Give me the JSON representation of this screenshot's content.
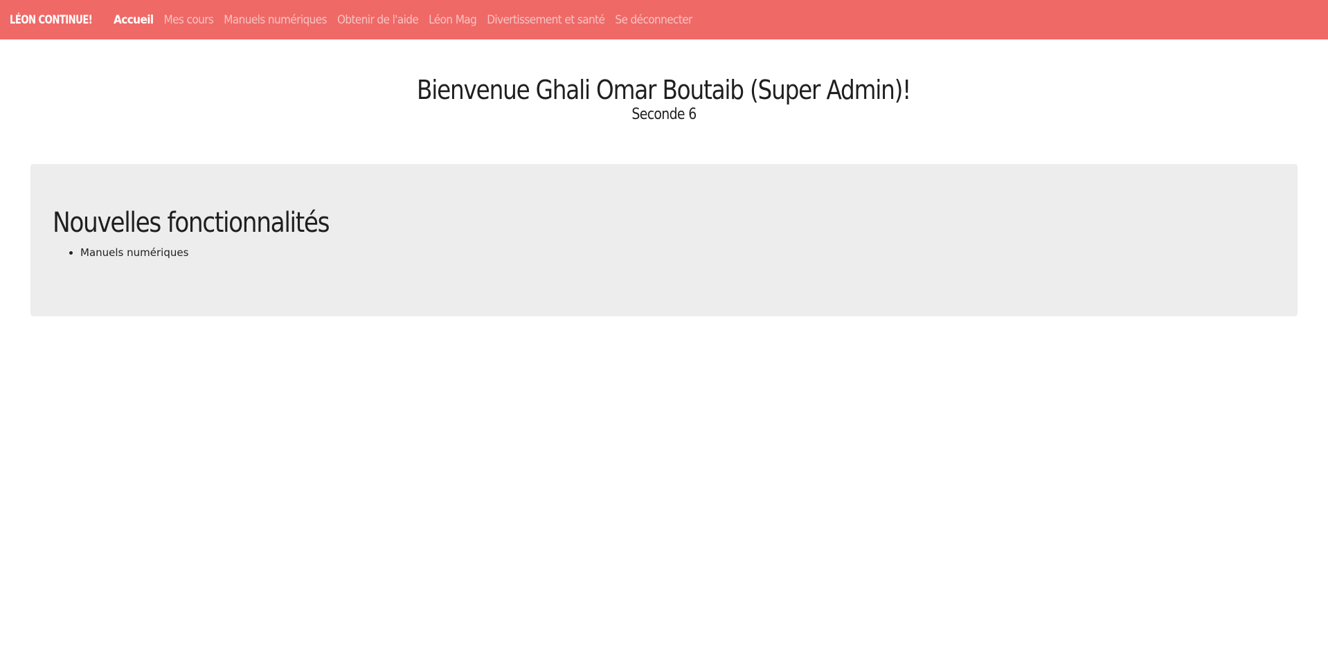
{
  "navbar": {
    "brand": "LÉON CONTINUE!",
    "links": [
      {
        "label": "Accueil",
        "active": true
      },
      {
        "label": "Mes cours",
        "active": false
      },
      {
        "label": "Manuels numériques",
        "active": false
      },
      {
        "label": "Obtenir de l'aide",
        "active": false
      },
      {
        "label": "Léon Mag",
        "active": false
      },
      {
        "label": "Divertissement et santé",
        "active": false
      },
      {
        "label": "Se déconnecter",
        "active": false
      }
    ]
  },
  "welcome": {
    "title": "Bienvenue Ghali Omar Boutaib (Super Admin)!",
    "subtitle": "Seconde 6"
  },
  "features": {
    "heading": "Nouvelles fonctionnalités",
    "items": [
      "Manuels numériques"
    ]
  },
  "colors": {
    "navbar_bg": "#ef6967",
    "panel_bg": "#ededed"
  }
}
